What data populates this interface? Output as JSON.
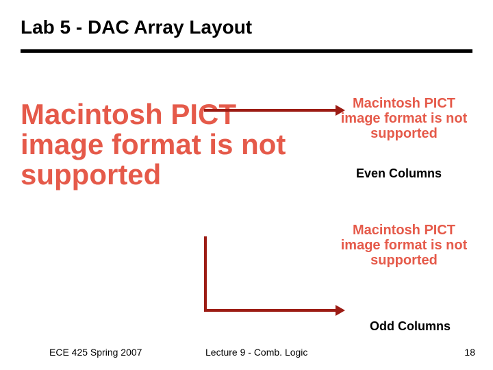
{
  "title": "Lab 5 - DAC Array Layout",
  "pict_error": "Macintosh PICT image format is not supported",
  "labels": {
    "even": "Even Columns",
    "odd": "Odd Columns"
  },
  "footer": {
    "left": "ECE 425 Spring 2007",
    "center": "Lecture 9 - Comb. Logic",
    "page": "18"
  }
}
